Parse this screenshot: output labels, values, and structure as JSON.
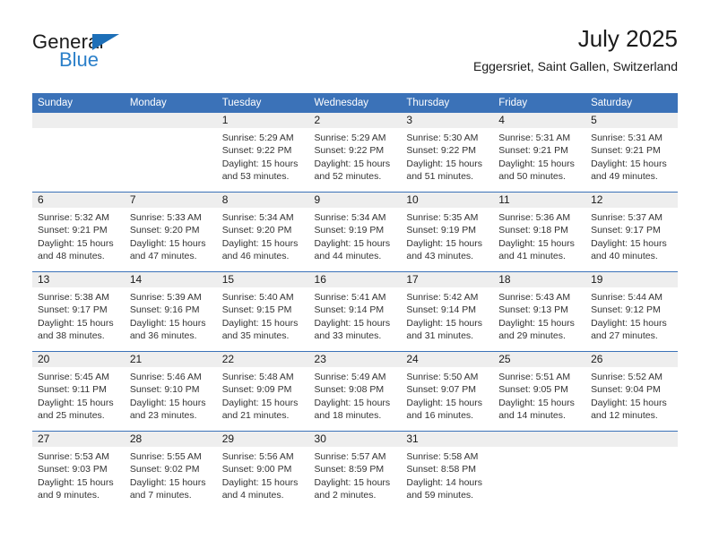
{
  "brand": {
    "name_top": "General",
    "name_bottom": "Blue",
    "triangle_icon": "triangle-icon",
    "accent_color": "#2a7fc9"
  },
  "header": {
    "title": "July 2025",
    "subtitle": "Eggersriet, Saint Gallen, Switzerland"
  },
  "theme": {
    "header_bg": "#3b72b8",
    "daynum_bg": "#eeeeee",
    "row_border": "#3b72b8",
    "text": "#333333"
  },
  "weekday_headers": [
    "Sunday",
    "Monday",
    "Tuesday",
    "Wednesday",
    "Thursday",
    "Friday",
    "Saturday"
  ],
  "weeks": [
    {
      "days": [
        {
          "num": "",
          "sunrise": "",
          "sunset": "",
          "daylight_line1": "",
          "daylight_line2": ""
        },
        {
          "num": "",
          "sunrise": "",
          "sunset": "",
          "daylight_line1": "",
          "daylight_line2": ""
        },
        {
          "num": "1",
          "sunrise": "Sunrise: 5:29 AM",
          "sunset": "Sunset: 9:22 PM",
          "daylight_line1": "Daylight: 15 hours",
          "daylight_line2": "and 53 minutes."
        },
        {
          "num": "2",
          "sunrise": "Sunrise: 5:29 AM",
          "sunset": "Sunset: 9:22 PM",
          "daylight_line1": "Daylight: 15 hours",
          "daylight_line2": "and 52 minutes."
        },
        {
          "num": "3",
          "sunrise": "Sunrise: 5:30 AM",
          "sunset": "Sunset: 9:22 PM",
          "daylight_line1": "Daylight: 15 hours",
          "daylight_line2": "and 51 minutes."
        },
        {
          "num": "4",
          "sunrise": "Sunrise: 5:31 AM",
          "sunset": "Sunset: 9:21 PM",
          "daylight_line1": "Daylight: 15 hours",
          "daylight_line2": "and 50 minutes."
        },
        {
          "num": "5",
          "sunrise": "Sunrise: 5:31 AM",
          "sunset": "Sunset: 9:21 PM",
          "daylight_line1": "Daylight: 15 hours",
          "daylight_line2": "and 49 minutes."
        }
      ]
    },
    {
      "days": [
        {
          "num": "6",
          "sunrise": "Sunrise: 5:32 AM",
          "sunset": "Sunset: 9:21 PM",
          "daylight_line1": "Daylight: 15 hours",
          "daylight_line2": "and 48 minutes."
        },
        {
          "num": "7",
          "sunrise": "Sunrise: 5:33 AM",
          "sunset": "Sunset: 9:20 PM",
          "daylight_line1": "Daylight: 15 hours",
          "daylight_line2": "and 47 minutes."
        },
        {
          "num": "8",
          "sunrise": "Sunrise: 5:34 AM",
          "sunset": "Sunset: 9:20 PM",
          "daylight_line1": "Daylight: 15 hours",
          "daylight_line2": "and 46 minutes."
        },
        {
          "num": "9",
          "sunrise": "Sunrise: 5:34 AM",
          "sunset": "Sunset: 9:19 PM",
          "daylight_line1": "Daylight: 15 hours",
          "daylight_line2": "and 44 minutes."
        },
        {
          "num": "10",
          "sunrise": "Sunrise: 5:35 AM",
          "sunset": "Sunset: 9:19 PM",
          "daylight_line1": "Daylight: 15 hours",
          "daylight_line2": "and 43 minutes."
        },
        {
          "num": "11",
          "sunrise": "Sunrise: 5:36 AM",
          "sunset": "Sunset: 9:18 PM",
          "daylight_line1": "Daylight: 15 hours",
          "daylight_line2": "and 41 minutes."
        },
        {
          "num": "12",
          "sunrise": "Sunrise: 5:37 AM",
          "sunset": "Sunset: 9:17 PM",
          "daylight_line1": "Daylight: 15 hours",
          "daylight_line2": "and 40 minutes."
        }
      ]
    },
    {
      "days": [
        {
          "num": "13",
          "sunrise": "Sunrise: 5:38 AM",
          "sunset": "Sunset: 9:17 PM",
          "daylight_line1": "Daylight: 15 hours",
          "daylight_line2": "and 38 minutes."
        },
        {
          "num": "14",
          "sunrise": "Sunrise: 5:39 AM",
          "sunset": "Sunset: 9:16 PM",
          "daylight_line1": "Daylight: 15 hours",
          "daylight_line2": "and 36 minutes."
        },
        {
          "num": "15",
          "sunrise": "Sunrise: 5:40 AM",
          "sunset": "Sunset: 9:15 PM",
          "daylight_line1": "Daylight: 15 hours",
          "daylight_line2": "and 35 minutes."
        },
        {
          "num": "16",
          "sunrise": "Sunrise: 5:41 AM",
          "sunset": "Sunset: 9:14 PM",
          "daylight_line1": "Daylight: 15 hours",
          "daylight_line2": "and 33 minutes."
        },
        {
          "num": "17",
          "sunrise": "Sunrise: 5:42 AM",
          "sunset": "Sunset: 9:14 PM",
          "daylight_line1": "Daylight: 15 hours",
          "daylight_line2": "and 31 minutes."
        },
        {
          "num": "18",
          "sunrise": "Sunrise: 5:43 AM",
          "sunset": "Sunset: 9:13 PM",
          "daylight_line1": "Daylight: 15 hours",
          "daylight_line2": "and 29 minutes."
        },
        {
          "num": "19",
          "sunrise": "Sunrise: 5:44 AM",
          "sunset": "Sunset: 9:12 PM",
          "daylight_line1": "Daylight: 15 hours",
          "daylight_line2": "and 27 minutes."
        }
      ]
    },
    {
      "days": [
        {
          "num": "20",
          "sunrise": "Sunrise: 5:45 AM",
          "sunset": "Sunset: 9:11 PM",
          "daylight_line1": "Daylight: 15 hours",
          "daylight_line2": "and 25 minutes."
        },
        {
          "num": "21",
          "sunrise": "Sunrise: 5:46 AM",
          "sunset": "Sunset: 9:10 PM",
          "daylight_line1": "Daylight: 15 hours",
          "daylight_line2": "and 23 minutes."
        },
        {
          "num": "22",
          "sunrise": "Sunrise: 5:48 AM",
          "sunset": "Sunset: 9:09 PM",
          "daylight_line1": "Daylight: 15 hours",
          "daylight_line2": "and 21 minutes."
        },
        {
          "num": "23",
          "sunrise": "Sunrise: 5:49 AM",
          "sunset": "Sunset: 9:08 PM",
          "daylight_line1": "Daylight: 15 hours",
          "daylight_line2": "and 18 minutes."
        },
        {
          "num": "24",
          "sunrise": "Sunrise: 5:50 AM",
          "sunset": "Sunset: 9:07 PM",
          "daylight_line1": "Daylight: 15 hours",
          "daylight_line2": "and 16 minutes."
        },
        {
          "num": "25",
          "sunrise": "Sunrise: 5:51 AM",
          "sunset": "Sunset: 9:05 PM",
          "daylight_line1": "Daylight: 15 hours",
          "daylight_line2": "and 14 minutes."
        },
        {
          "num": "26",
          "sunrise": "Sunrise: 5:52 AM",
          "sunset": "Sunset: 9:04 PM",
          "daylight_line1": "Daylight: 15 hours",
          "daylight_line2": "and 12 minutes."
        }
      ]
    },
    {
      "days": [
        {
          "num": "27",
          "sunrise": "Sunrise: 5:53 AM",
          "sunset": "Sunset: 9:03 PM",
          "daylight_line1": "Daylight: 15 hours",
          "daylight_line2": "and 9 minutes."
        },
        {
          "num": "28",
          "sunrise": "Sunrise: 5:55 AM",
          "sunset": "Sunset: 9:02 PM",
          "daylight_line1": "Daylight: 15 hours",
          "daylight_line2": "and 7 minutes."
        },
        {
          "num": "29",
          "sunrise": "Sunrise: 5:56 AM",
          "sunset": "Sunset: 9:00 PM",
          "daylight_line1": "Daylight: 15 hours",
          "daylight_line2": "and 4 minutes."
        },
        {
          "num": "30",
          "sunrise": "Sunrise: 5:57 AM",
          "sunset": "Sunset: 8:59 PM",
          "daylight_line1": "Daylight: 15 hours",
          "daylight_line2": "and 2 minutes."
        },
        {
          "num": "31",
          "sunrise": "Sunrise: 5:58 AM",
          "sunset": "Sunset: 8:58 PM",
          "daylight_line1": "Daylight: 14 hours",
          "daylight_line2": "and 59 minutes."
        },
        {
          "num": "",
          "sunrise": "",
          "sunset": "",
          "daylight_line1": "",
          "daylight_line2": ""
        },
        {
          "num": "",
          "sunrise": "",
          "sunset": "",
          "daylight_line1": "",
          "daylight_line2": ""
        }
      ]
    }
  ]
}
